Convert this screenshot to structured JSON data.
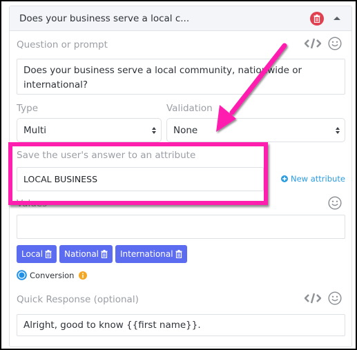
{
  "header": {
    "title": "Does your business serve a local c...",
    "delete_icon": "trash-icon",
    "collapse_icon": "caret-up-icon"
  },
  "question": {
    "label": "Question or prompt",
    "value": "Does your business serve a local community, nationwide or international?",
    "code_icon": "code-icon",
    "emoji_icon": "smiley-icon"
  },
  "type": {
    "label": "Type",
    "selected": "Multi"
  },
  "validation": {
    "label": "Validation",
    "selected": "None"
  },
  "attribute": {
    "label": "Save the user's answer to an attribute",
    "value": "LOCAL BUSINESS",
    "new_attribute_label": "New attribute",
    "new_attribute_icon": "plus-circle-icon"
  },
  "values": {
    "label": "Values",
    "input_value": "",
    "emoji_icon": "smiley-icon",
    "tags": [
      {
        "label": "Local",
        "icon": "trash-icon"
      },
      {
        "label": "National",
        "icon": "trash-icon"
      },
      {
        "label": "International",
        "icon": "trash-icon"
      }
    ]
  },
  "conversion": {
    "label": "Conversion",
    "checked": true,
    "info_icon": "info-icon"
  },
  "quick_response": {
    "label": "Quick Response (optional)",
    "value": "Alright, good to know {{first name}}.",
    "code_icon": "code-icon",
    "emoji_icon": "smiley-icon"
  },
  "annotation": {
    "color": "#ff1fae",
    "type": "arrow-and-highlight-box"
  },
  "colors": {
    "tag_bg": "#5b6cf0",
    "delete_red": "#e0404f",
    "link_blue": "#2b9be0",
    "radio_blue": "#1e90e8",
    "info_orange": "#f5a623"
  }
}
